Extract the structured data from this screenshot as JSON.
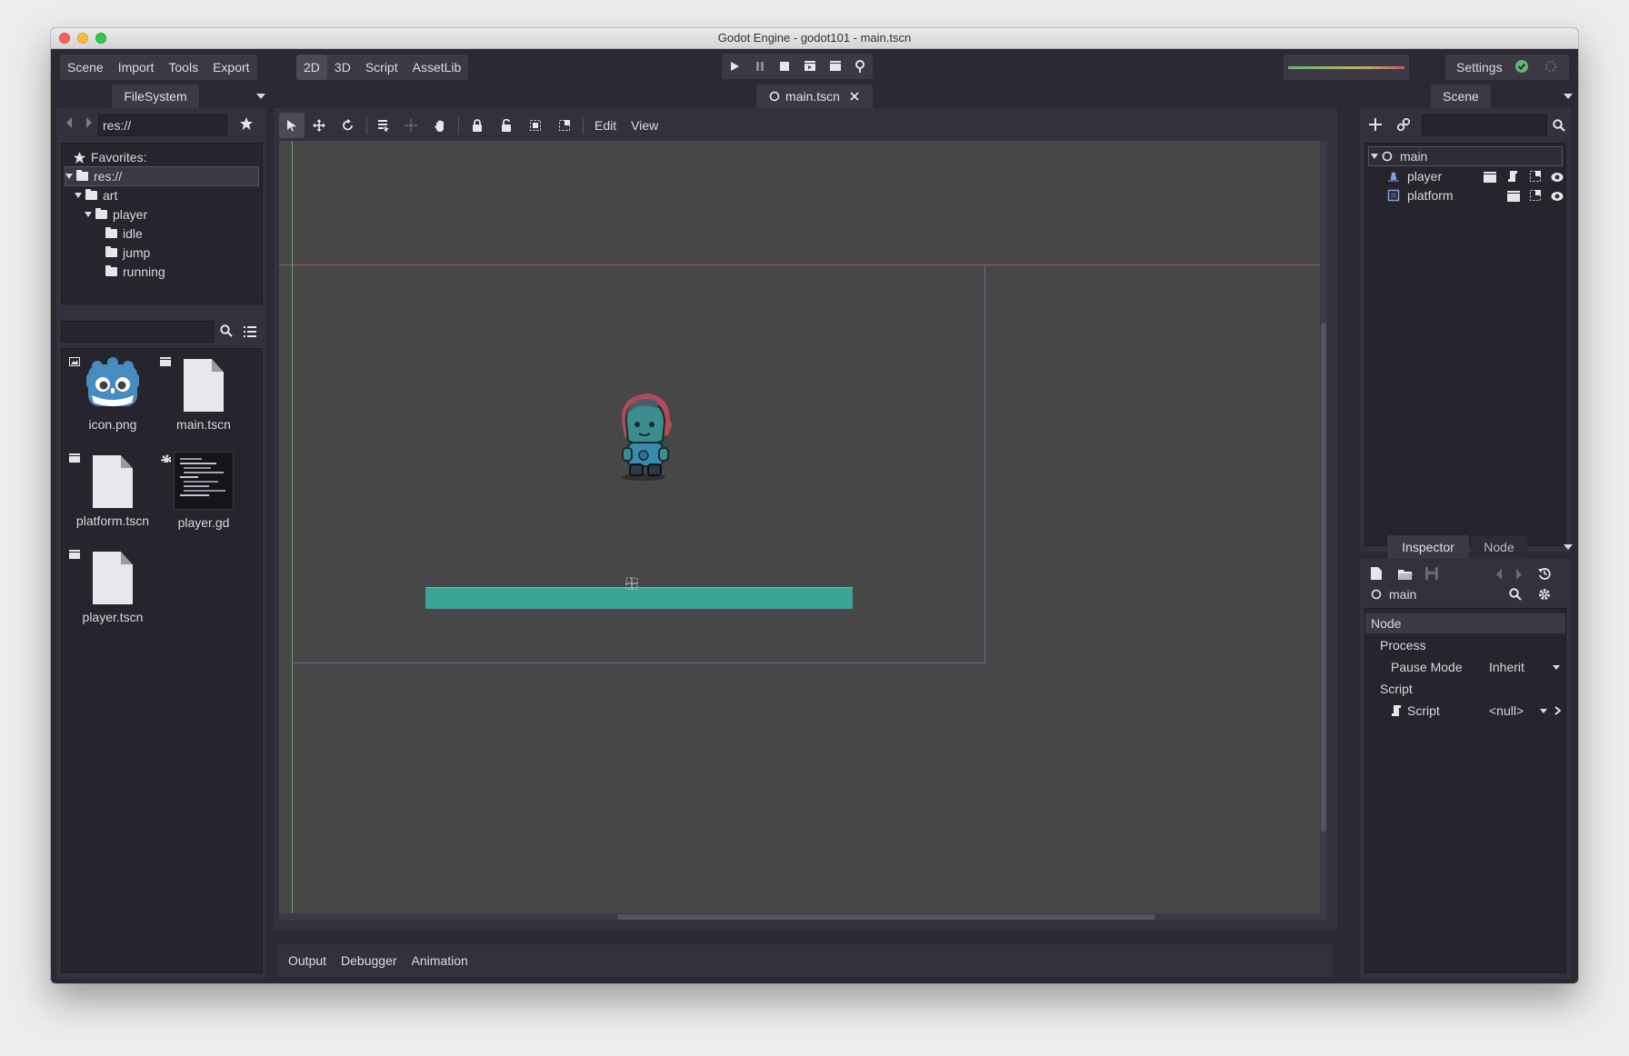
{
  "window": {
    "title": "Godot Engine - godot101 - main.tscn"
  },
  "menu": {
    "scene": "Scene",
    "import": "Import",
    "tools": "Tools",
    "export": "Export"
  },
  "workspaces": {
    "w2d": "2D",
    "w3d": "3D",
    "script": "Script",
    "assetlib": "AssetLib"
  },
  "settings_label": "Settings",
  "filesystem": {
    "tab": "FileSystem",
    "path": "res://",
    "favorites_label": "Favorites:",
    "tree": [
      {
        "label": "res://"
      },
      {
        "label": "art"
      },
      {
        "label": "player"
      },
      {
        "label": "idle"
      },
      {
        "label": "jump"
      },
      {
        "label": "running"
      }
    ],
    "search_placeholder": "",
    "files": [
      {
        "name": "icon.png"
      },
      {
        "name": "main.tscn"
      },
      {
        "name": "platform.tscn"
      },
      {
        "name": "player.gd"
      },
      {
        "name": "player.tscn"
      }
    ]
  },
  "editor": {
    "scene_tab": "main.tscn",
    "toolbar": {
      "edit": "Edit",
      "view": "View"
    }
  },
  "bottom_panel": {
    "output": "Output",
    "debugger": "Debugger",
    "animation": "Animation"
  },
  "scene_dock": {
    "tab": "Scene",
    "filter_placeholder": "",
    "nodes": [
      {
        "name": "main"
      },
      {
        "name": "player"
      },
      {
        "name": "platform"
      }
    ]
  },
  "inspector": {
    "tab_inspector": "Inspector",
    "tab_node": "Node",
    "object_name": "main",
    "section_node": "Node",
    "group_process": "Process",
    "pause_mode_label": "Pause Mode",
    "pause_mode_value": "Inherit",
    "group_script": "Script",
    "script_label": "Script",
    "script_value": "<null>"
  },
  "colors": {
    "platform": "#3aa597",
    "background": "#2b2a33",
    "viewport": "#474747"
  }
}
